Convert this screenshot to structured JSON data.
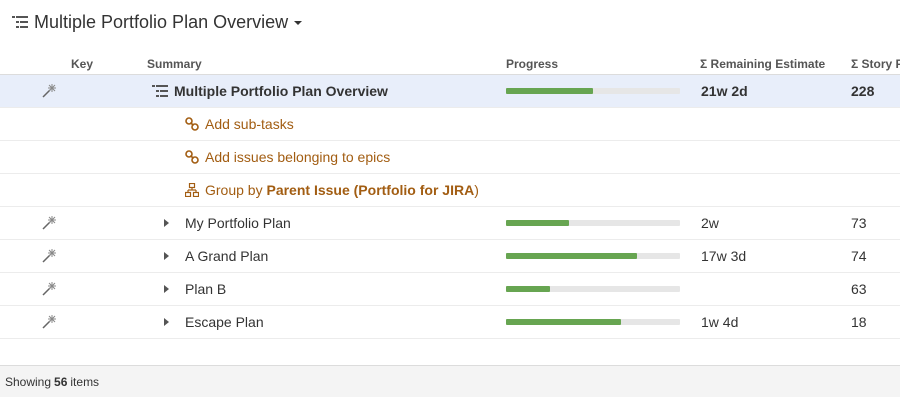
{
  "page": {
    "title": "Multiple Portfolio Plan Overview"
  },
  "columns": {
    "key": "Key",
    "summary": "Summary",
    "progress": "Progress",
    "remaining": "Σ Remaining Estimate",
    "story_points": "Σ Story P"
  },
  "rows": [
    {
      "summary": "Multiple Portfolio Plan Overview",
      "progress": 0.5,
      "remaining": "21w 2d",
      "story_points": "228"
    },
    {
      "summary": "Add sub-tasks"
    },
    {
      "summary": "Add issues belonging to epics"
    },
    {
      "prefix": "Group by ",
      "emphasis": "Parent Issue (Portfolio for JIRA",
      "suffix": ")"
    },
    {
      "summary": "My Portfolio Plan",
      "progress": 0.36,
      "remaining": "2w",
      "story_points": "73"
    },
    {
      "summary": "A Grand Plan",
      "progress": 0.75,
      "remaining": "17w 3d",
      "story_points": "74"
    },
    {
      "summary": "Plan B",
      "progress": 0.25,
      "remaining": "",
      "story_points": "63"
    },
    {
      "summary": "Escape Plan",
      "progress": 0.66,
      "remaining": "1w 4d",
      "story_points": "18"
    }
  ],
  "footer": {
    "prefix": "Showing",
    "count": "56",
    "suffix": "items"
  },
  "colors": {
    "progress_fill": "#67a551",
    "progress_track": "#e6e6e6",
    "generator_text": "#a25d12",
    "selected_row": "#e8eefa"
  },
  "icons": {
    "title": "structure-icon",
    "key": "wand-icon",
    "generator_link": "link-icon",
    "generator_group": "hierarchy-icon",
    "folder": "folder-icon",
    "toggle": "expand-arrow-icon"
  }
}
